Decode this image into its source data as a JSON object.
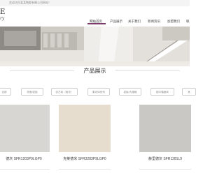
{
  "topbar": {
    "text": "欢迎访问某某陶瓷有限公司网站！"
  },
  "logo": {
    "letter": "E",
    "subtitle": "ry"
  },
  "nav": {
    "items": [
      {
        "label": "网站首页"
      },
      {
        "label": "产品展示"
      },
      {
        "label": "关于我们"
      },
      {
        "label": "新闻资讯"
      },
      {
        "label": "加盟我们"
      },
      {
        "label": "联"
      }
    ],
    "active_index": 0
  },
  "products_section": {
    "title": "产品展示",
    "filters": [
      {
        "label": "全部"
      },
      {
        "label": "亮面/岩板"
      },
      {
        "label": "仿古砖（哑光）"
      },
      {
        "label": "柔光砖系列"
      },
      {
        "label": "岩板/大规格"
      },
      {
        "label": "超平釉面砖"
      },
      {
        "label": "其"
      }
    ],
    "products": [
      {
        "name": "德灰 SFR1203P9LGP0",
        "tone": "#d8d6d2"
      },
      {
        "name": "克莱德米 SFR3283P9LGP0",
        "tone": "#e6ddcf"
      },
      {
        "name": "赫里德灰 SFR1281L9",
        "tone": "#c9c8c5"
      }
    ]
  },
  "colors": {
    "accent": "#7a3a6a",
    "filter_border": "#cfcfcf"
  }
}
